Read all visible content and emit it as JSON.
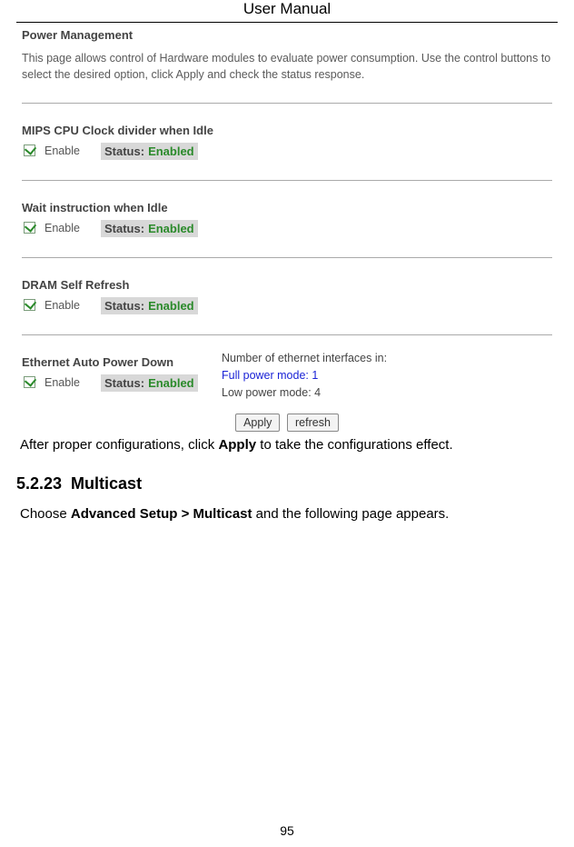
{
  "header": {
    "title": "User Manual"
  },
  "power_mgmt": {
    "title": "Power Management",
    "desc": "This page allows control of Hardware modules to evaluate power consumption. Use the control buttons to select the desired option, click Apply and check the status response.",
    "sections": {
      "mips": {
        "label": "MIPS CPU Clock divider when Idle",
        "enable": "Enable",
        "status_label": "Status:",
        "status_value": "Enabled"
      },
      "wait": {
        "label": "Wait instruction when Idle",
        "enable": "Enable",
        "status_label": "Status:",
        "status_value": "Enabled"
      },
      "dram": {
        "label": "DRAM Self Refresh",
        "enable": "Enable",
        "status_label": "Status:",
        "status_value": "Enabled"
      },
      "eth": {
        "label": "Ethernet Auto Power Down",
        "enable": "Enable",
        "status_label": "Status:",
        "status_value": "Enabled",
        "info_heading": "Number of ethernet interfaces in:",
        "full_mode": "Full power mode: 1",
        "low_mode": "Low power mode: 4"
      }
    },
    "buttons": {
      "apply": "Apply",
      "refresh": "refresh"
    }
  },
  "post_text": {
    "before": "After proper configurations, click ",
    "bold": "Apply",
    "after": " to take the configurations effect."
  },
  "section_heading": {
    "number": "5.2.23",
    "title": "Multicast"
  },
  "multicast_text": {
    "before": "Choose ",
    "path": "Advanced Setup > Multicast",
    "after": " and the following page appears."
  },
  "page_number": "95"
}
